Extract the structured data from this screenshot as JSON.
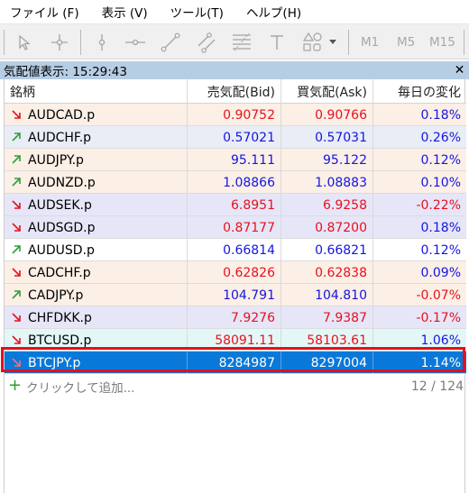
{
  "menu": [
    "ファイル (F)",
    "表示 (V)",
    "ツール(T)",
    "ヘルプ(H)"
  ],
  "toolbar": {
    "icons": [
      "cursor-icon",
      "crosshair-icon",
      "vertical-line-icon",
      "horizontal-line-icon",
      "trend-line-icon",
      "channel-icon",
      "fibonacci-icon",
      "text-icon",
      "shapes-icon",
      "dropdown-arrow-icon"
    ],
    "timeframes": [
      "M1",
      "M5",
      "M15"
    ]
  },
  "panel": {
    "title": "気配値表示: 15:29:43",
    "close": "✕"
  },
  "table": {
    "headers": [
      "銘柄",
      "売気配(Bid)",
      "買気配(Ask)",
      "毎日の変化"
    ],
    "rows": [
      {
        "symbol": "AUDCAD.p",
        "bid": "0.90752",
        "ask": "0.90766",
        "change": "0.18%",
        "dir": "down",
        "bg": "#fbefe6",
        "price_color": "#e8101d",
        "change_color": "#1515e0"
      },
      {
        "symbol": "AUDCHF.p",
        "bid": "0.57021",
        "ask": "0.57031",
        "change": "0.26%",
        "dir": "up",
        "bg": "#e9edf6",
        "price_color": "#1515e0",
        "change_color": "#1515e0"
      },
      {
        "symbol": "AUDJPY.p",
        "bid": "95.111",
        "ask": "95.122",
        "change": "0.12%",
        "dir": "up",
        "bg": "#fbefe6",
        "price_color": "#1515e0",
        "change_color": "#1515e0"
      },
      {
        "symbol": "AUDNZD.p",
        "bid": "1.08866",
        "ask": "1.08883",
        "change": "0.10%",
        "dir": "up",
        "bg": "#fbefe6",
        "price_color": "#1515e0",
        "change_color": "#1515e0"
      },
      {
        "symbol": "AUDSEK.p",
        "bid": "6.8951",
        "ask": "6.9258",
        "change": "-0.22%",
        "dir": "down",
        "bg": "#e6e6f8",
        "price_color": "#e8101d",
        "change_color": "#e8101d"
      },
      {
        "symbol": "AUDSGD.p",
        "bid": "0.87177",
        "ask": "0.87200",
        "change": "0.18%",
        "dir": "down",
        "bg": "#e6e6f8",
        "price_color": "#e8101d",
        "change_color": "#1515e0"
      },
      {
        "symbol": "AUDUSD.p",
        "bid": "0.66814",
        "ask": "0.66821",
        "change": "0.12%",
        "dir": "up",
        "bg": "#ffffff",
        "price_color": "#1515e0",
        "change_color": "#1515e0"
      },
      {
        "symbol": "CADCHF.p",
        "bid": "0.62826",
        "ask": "0.62838",
        "change": "0.09%",
        "dir": "down",
        "bg": "#fbefe6",
        "price_color": "#e8101d",
        "change_color": "#1515e0"
      },
      {
        "symbol": "CADJPY.p",
        "bid": "104.791",
        "ask": "104.810",
        "change": "-0.07%",
        "dir": "up",
        "bg": "#fbefe6",
        "price_color": "#1515e0",
        "change_color": "#e8101d"
      },
      {
        "symbol": "CHFDKK.p",
        "bid": "7.9276",
        "ask": "7.9387",
        "change": "-0.17%",
        "dir": "down",
        "bg": "#e6e6f8",
        "price_color": "#e8101d",
        "change_color": "#e8101d"
      },
      {
        "symbol": "BTCUSD.p",
        "bid": "58091.11",
        "ask": "58103.61",
        "change": "1.06%",
        "dir": "down",
        "bg": "#e3f7f7",
        "price_color": "#e8101d",
        "change_color": "#1515e0"
      },
      {
        "symbol": "BTCJPY.p",
        "bid": "8284987",
        "ask": "8297004",
        "change": "1.14%",
        "dir": "down",
        "bg": "#0a78d8",
        "price_color": "#ffffff",
        "change_color": "#ffffff",
        "selected": true
      }
    ],
    "add_label": "クリックして追加...",
    "count": "12 / 124"
  },
  "colors": {
    "up_arrow": "#2e9e3a",
    "down_arrow": "#e8101d",
    "selection_outline": "#e3101d"
  }
}
